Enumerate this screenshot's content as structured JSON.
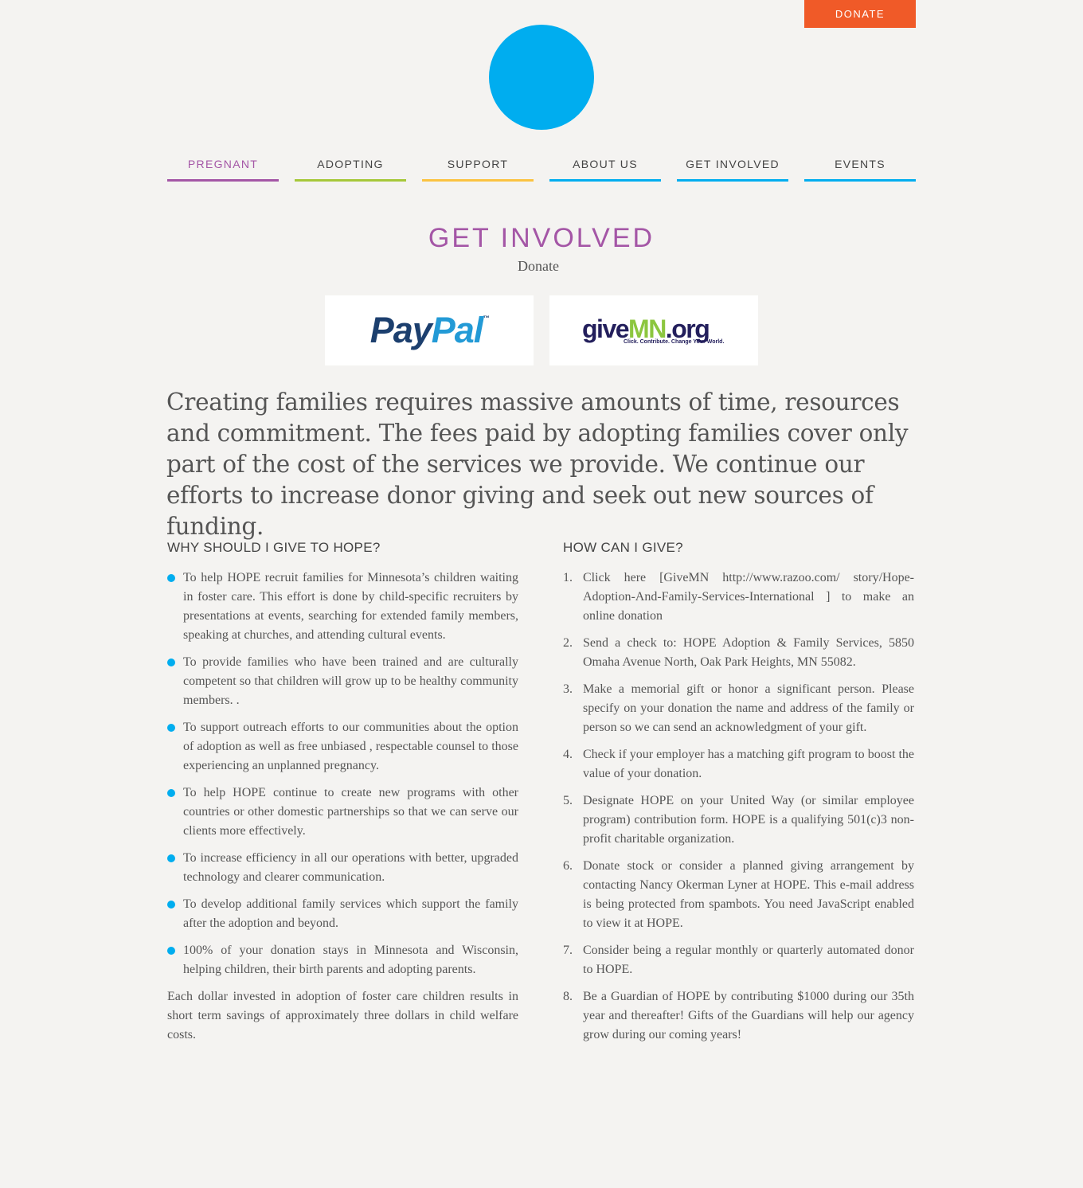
{
  "header": {
    "donate_label": "DONATE"
  },
  "nav": {
    "items": [
      {
        "label": "PREGNANT",
        "color": "#a456a6"
      },
      {
        "label": "ADOPTING",
        "color": "#a6c83a"
      },
      {
        "label": "SUPPORT",
        "color": "#fbc342"
      },
      {
        "label": "ABOUT US",
        "color": "#00adef"
      },
      {
        "label": "GET INVOLVED",
        "color": "#00adef"
      },
      {
        "label": "EVENTS",
        "color": "#00adef"
      }
    ]
  },
  "page": {
    "title": "GET INVOLVED",
    "subtitle": "Donate",
    "paypal": {
      "part1": "Pay",
      "part2": "Pal",
      "tm": "™"
    },
    "givemn": {
      "part1": "give",
      "part2": "MN",
      "part3": ".org",
      "tagline": "Click. Contribute. Change Your World."
    },
    "intro": "Creating families requires massive amounts of time, resources and commitment. The fees paid by adopting families cover only part of the cost of the services we provide. We continue our efforts to increase donor giving and seek out new sources of funding."
  },
  "why": {
    "heading": "WHY SHOULD I GIVE TO HOPE?",
    "items": [
      "To help HOPE recruit families for Minnesota’s children waiting in foster care.  This effort is done by child-specific recruiters by presentations at events, searching for extended family members, speaking at churches, and attending cultural events.",
      "To provide families who have been trained and are culturally competent so that children will grow up to be healthy community members.  .",
      "To support outreach efforts to our communities about the option of adoption as well as free unbiased , respectable counsel to those experiencing an unplanned pregnancy.",
      "To help HOPE continue to create new programs with other countries or other domestic partnerships so that we can serve our clients more effectively.",
      "To increase efficiency in all our operations with better, upgraded technology and clearer communication.",
      "To develop additional family services which support the family after the adoption and beyond.",
      "100% of your donation stays in Minnesota and Wisconsin, helping children, their birth parents and adopting parents."
    ],
    "closing": "Each dollar invested in adoption of foster care children results in short term savings of approximately three dollars in child welfare costs."
  },
  "how": {
    "heading": "HOW CAN I GIVE?",
    "items": [
      {
        "num": "1.",
        "text": "Click here [GiveMN http://www.razoo.com/ story/Hope-Adoption-And-Family-Services-International ] to make an online donation"
      },
      {
        "num": "2.",
        "text": "Send a check to: HOPE Adoption & Family Services, 5850 Omaha Avenue North, Oak Park Heights, MN 55082."
      },
      {
        "num": "3.",
        "text": "Make a memorial gift or honor a significant person.  Please specify on your donation the name and address of the family or person so we can  send an acknowledgment of your gift."
      },
      {
        "num": "4.",
        "text": "Check if your employer has a matching gift program to boost the value of your donation."
      },
      {
        "num": "5.",
        "text": "Designate HOPE on your United Way (or similar employee program) contribution form. HOPE is a qualifying 501(c)3 non-profit charitable organization."
      },
      {
        "num": "6.",
        "text": "Donate stock or consider a planned giving arrangement by contacting Nancy Okerman Lyner at HOPE. This e-mail address is being protected from spambots. You need JavaScript enabled to view it at HOPE."
      },
      {
        "num": "7.",
        "text": "Consider being a regular monthly or quarterly automated donor to HOPE."
      },
      {
        "num": "8.",
        "text": "Be a Guardian of HOPE by contributing $1000 during our 35th year and thereafter!  Gifts of the Guardians will help our agency grow during our coming years!"
      }
    ]
  },
  "colors": {
    "accent": "#00adef",
    "brand_purple": "#a456a6",
    "donate": "#f05a28",
    "background": "#f4f3f1"
  }
}
